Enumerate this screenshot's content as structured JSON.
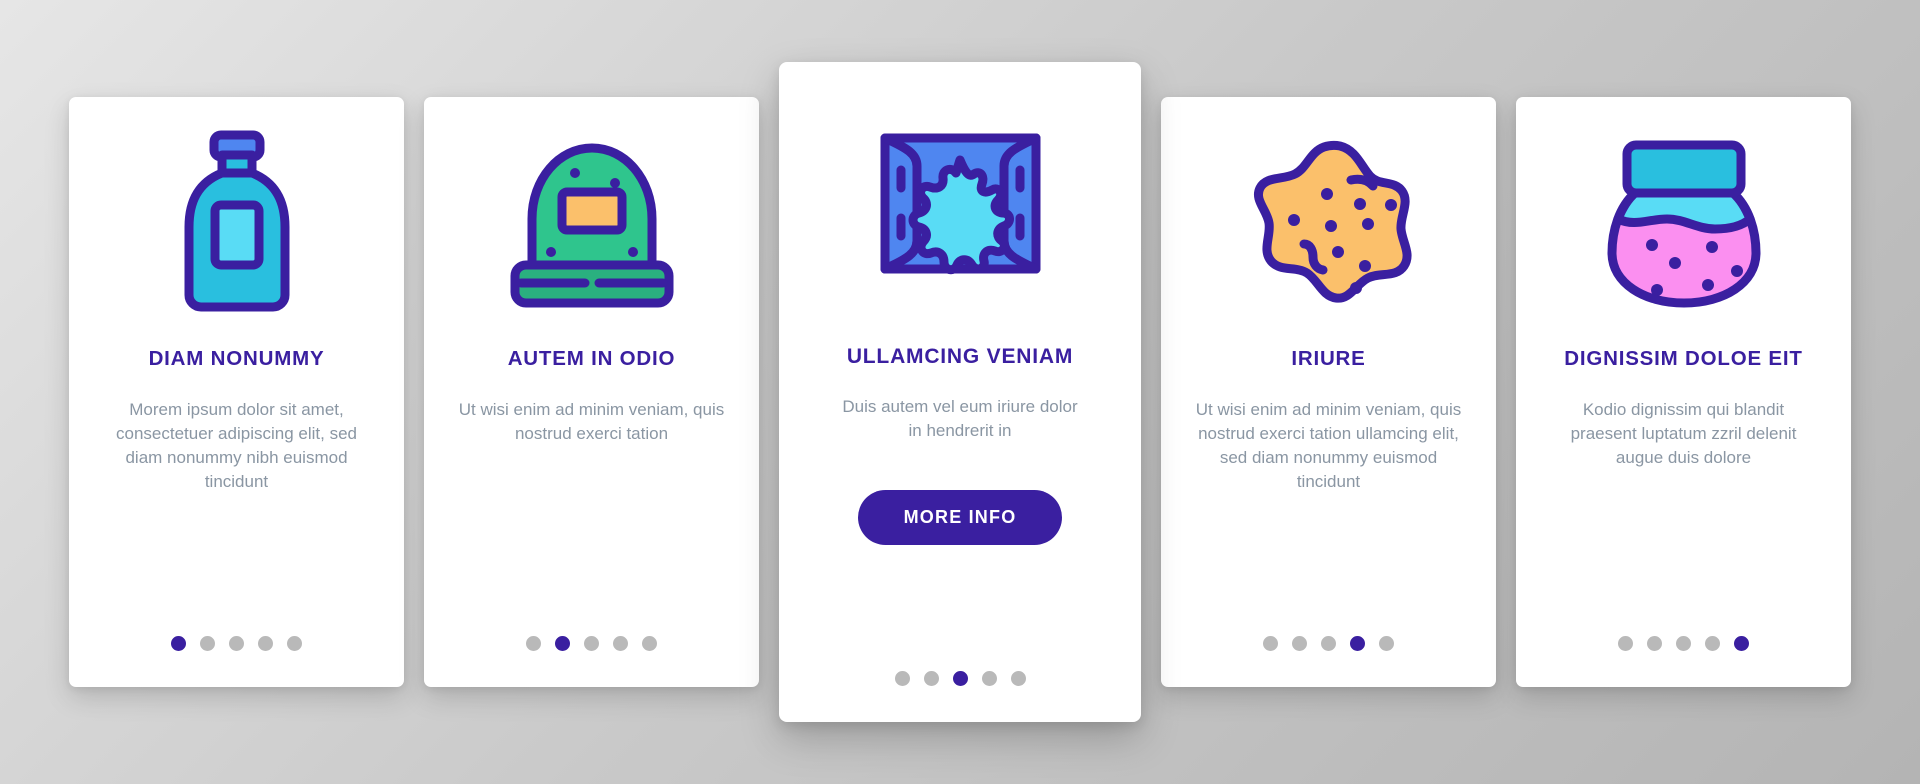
{
  "background": {
    "color_from": "#e6e6e6",
    "color_to": "#b4b4b4"
  },
  "theme": {
    "accent": "#3a1fa0",
    "title_color": "#3a1fa0",
    "body_color": "#8a96a3",
    "card_bg": "#ffffff",
    "dot_inactive": "#b9b9b9",
    "dot_active": "#3a1fa0",
    "icon_outline": "#3a1fa0",
    "icon_cyan": "#29bfdf",
    "icon_light_cyan": "#59dcf5",
    "icon_blue": "#4f86f0",
    "icon_green": "#2fc58d",
    "icon_orange": "#fbc06b",
    "icon_pink": "#fb8ff0"
  },
  "cards": [
    {
      "icon": "bottle-icon",
      "title": "DIAM NONUMMY",
      "body": "Morem ipsum dolor sit amet, consectetuer adipiscing elit, sed diam nonummy nibh euismod tincidunt",
      "featured": false,
      "button": null,
      "dots": {
        "count": 5,
        "active": 0
      }
    },
    {
      "icon": "beanie-hat-icon",
      "title": "AUTEM IN ODIO",
      "body": "Ut wisi enim ad minim veniam, quis nostrud exerci tation",
      "featured": false,
      "button": null,
      "dots": {
        "count": 5,
        "active": 1
      }
    },
    {
      "icon": "wet-wipes-packet-icon",
      "title": "ULLAMCING VENIAM",
      "body": "Duis autem vel eum iriure dolor in hendrerit in",
      "featured": true,
      "button": "MORE INFO",
      "dots": {
        "count": 5,
        "active": 2
      }
    },
    {
      "icon": "sponge-icon",
      "title": "IRIURE",
      "body": "Ut wisi enim ad minim veniam, quis nostrud exerci tation ullamcing elit, sed diam nonummy euismod tincidunt",
      "featured": false,
      "button": null,
      "dots": {
        "count": 5,
        "active": 3
      }
    },
    {
      "icon": "jam-jar-icon",
      "title": "DIGNISSIM DOLOE EIT",
      "body": "Kodio dignissim qui blandit praesent luptatum zzril delenit augue duis dolore",
      "featured": false,
      "button": null,
      "dots": {
        "count": 5,
        "active": 4
      }
    }
  ]
}
